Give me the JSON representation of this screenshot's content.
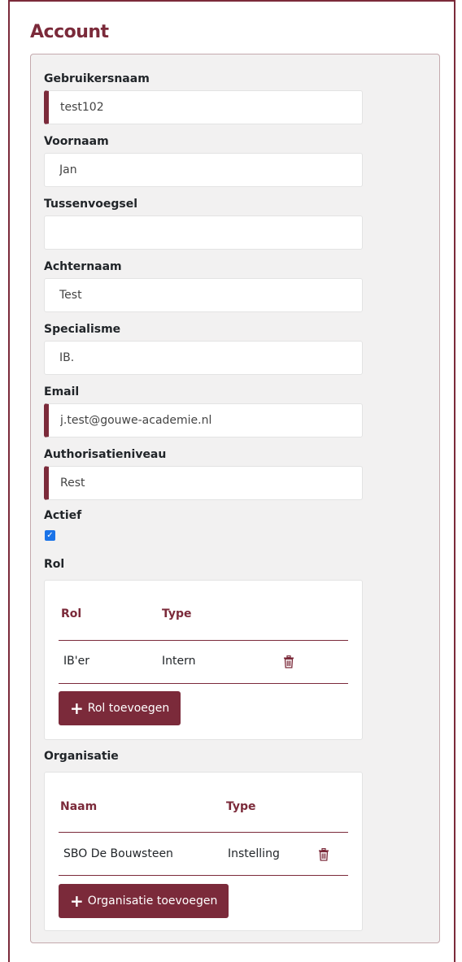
{
  "page": {
    "title": "Account"
  },
  "form": {
    "username": {
      "label": "Gebruikersnaam",
      "value": "test102"
    },
    "firstname": {
      "label": "Voornaam",
      "value": "Jan"
    },
    "infix": {
      "label": "Tussenvoegsel",
      "value": ""
    },
    "lastname": {
      "label": "Achternaam",
      "value": "Test"
    },
    "specialism": {
      "label": "Specialisme",
      "value": "IB."
    },
    "email": {
      "label": "Email",
      "value": "j.test@gouwe-academie.nl"
    },
    "authlevel": {
      "label": "Authorisatieniveau",
      "value": "Rest"
    },
    "active": {
      "label": "Actief",
      "checked": true
    }
  },
  "roles": {
    "section_label": "Rol",
    "headers": {
      "col1": "Rol",
      "col2": "Type"
    },
    "rows": [
      {
        "role": "IB'er",
        "type": "Intern"
      }
    ],
    "add_button": "Rol toevoegen"
  },
  "organisations": {
    "section_label": "Organisatie",
    "headers": {
      "col1": "Naam",
      "col2": "Type"
    },
    "rows": [
      {
        "name": "SBO De Bouwsteen",
        "type": "Instelling"
      }
    ],
    "add_button": "Organisatie toevoegen"
  },
  "colors": {
    "brand": "#7b2a3a",
    "panel": "#f2f1f1",
    "checkbox": "#1a73e8"
  },
  "icons": {
    "delete": "trash-icon",
    "add": "plus-icon",
    "check": "checkmark-icon"
  }
}
